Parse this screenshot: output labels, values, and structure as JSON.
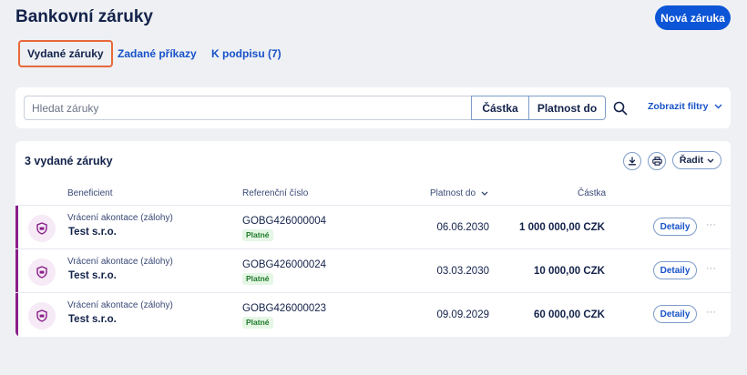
{
  "header": {
    "title": "Bankovní záruky",
    "new_button": "Nová záruka"
  },
  "tabs": [
    {
      "label": "Vydané záruky",
      "active": true
    },
    {
      "label": "Zadané příkazy",
      "active": false
    },
    {
      "label": "K podpisu (7)",
      "active": false
    }
  ],
  "search": {
    "placeholder": "Hledat záruky",
    "amount_button": "Částka",
    "validity_button": "Platnost do",
    "filters_link": "Zobrazit filtry"
  },
  "list": {
    "title": "3 vydané záruky",
    "sort_button": "Řadit",
    "columns": {
      "beneficiary": "Beneficient",
      "reference": "Referenční číslo",
      "validity": "Platnost do",
      "amount": "Částka"
    },
    "detail_label": "Detaily",
    "rows": [
      {
        "type": "Vrácení akontace (zálohy)",
        "company": "Test s.r.o.",
        "reference": "GOBG426000004",
        "status": "Platné",
        "validity": "06.06.2030",
        "amount": "1 000 000,00 CZK"
      },
      {
        "type": "Vrácení akontace (zálohy)",
        "company": "Test s.r.o.",
        "reference": "GOBG426000024",
        "status": "Platné",
        "validity": "03.03.2030",
        "amount": "10 000,00 CZK"
      },
      {
        "type": "Vrácení akontace (zálohy)",
        "company": "Test s.r.o.",
        "reference": "GOBG426000023",
        "status": "Platné",
        "validity": "09.09.2029",
        "amount": "60 000,00 CZK"
      }
    ]
  },
  "colors": {
    "primary": "#0c55d6",
    "annotation": "#e8683a",
    "row_accent": "#8a1f8a",
    "status_bg": "#e5f6e5",
    "status_text": "#1f7a2a"
  },
  "icons": {
    "search": "search-icon",
    "download": "download-icon",
    "print": "print-icon",
    "chevron": "chevron-down-icon",
    "guarantee": "shield-icon",
    "more": "more-icon"
  }
}
